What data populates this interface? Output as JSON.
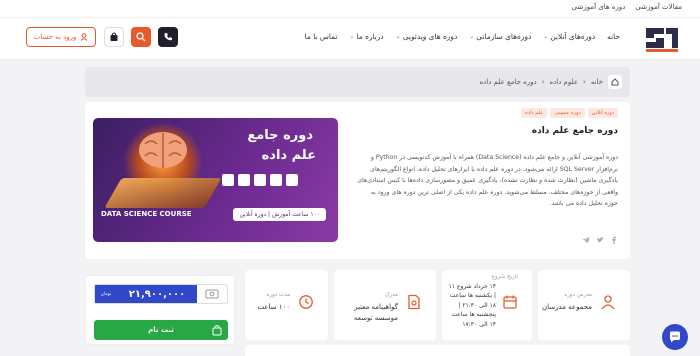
{
  "topbar": {
    "links": [
      "مقالات آموزشی",
      "دوره های آموزشی"
    ]
  },
  "header": {
    "logo_text": "سات",
    "nav": [
      {
        "label": "خانه",
        "has_menu": false
      },
      {
        "label": "دوره‌های آنلاین",
        "has_menu": true
      },
      {
        "label": "دوره‌های سازمانی",
        "has_menu": true
      },
      {
        "label": "دوره های ویدئویی",
        "has_menu": true
      },
      {
        "label": "درباره ما",
        "has_menu": true
      },
      {
        "label": "تماس با ما",
        "has_menu": false
      }
    ],
    "login_label": "ورود به حساب",
    "cart_count": "0",
    "accent": "#e85a2c"
  },
  "breadcrumb": [
    "خانه",
    "علوم داده",
    "دوره جامع علم داده"
  ],
  "course": {
    "tags": [
      "دوره آنلاین",
      "دوره عمومی",
      "علم داده"
    ],
    "title": "دوره جامع علم داده",
    "description": "دوره آموزشی آنلاین و جامع علم داده (Data Science) همراه با آموزش کدنویسی در Python و نرم‌افزار SQL Server ارائه می‌شود. در دوره علم داده با ابزارهای تحلیل داده، انواع الگوریتم‌های یادگیری ماشین (نظارت شده و نظارت نشده)، یادگیری عمیق و مصورسازی داده‌ها با کیس استادی‌های واقعی از حوزه‌های مختلف، مسلط می‌شوید. دوره علم داده یکی از اصلی ترین دوره های ورود به حوزه تحلیل داده می باشد.",
    "banner": {
      "title_line1": "دوره جامع",
      "title_line2": "علم داده",
      "subtitle": "DATA SCIENCE COURSE",
      "pill": "۱۰۰ ساعت آموزش | دوره آنلاین"
    }
  },
  "info": {
    "teacher": {
      "label": "مدرس دوره",
      "value": "مجموعه مدرسان"
    },
    "schedule": {
      "label": "تاریخ شروع",
      "value": "۱۴ خرداد شروع ۱۱ | یکشنبه ها ساعت ۱۸ الی ۲۱:۳۰ | پنجشنبه ها ساعت ۱۴ الی ۱۷:۳۰"
    },
    "certificate": {
      "label": "مدرک",
      "value": "گواهینامه معتبر موسسه توسعه"
    },
    "duration": {
      "label": "مدت دوره",
      "value": "۱۰۰ ساعت"
    }
  },
  "pricing": {
    "price": "۲۱,۹۰۰,۰۰۰",
    "currency": "تومان",
    "register_label": "ثبت نام"
  }
}
